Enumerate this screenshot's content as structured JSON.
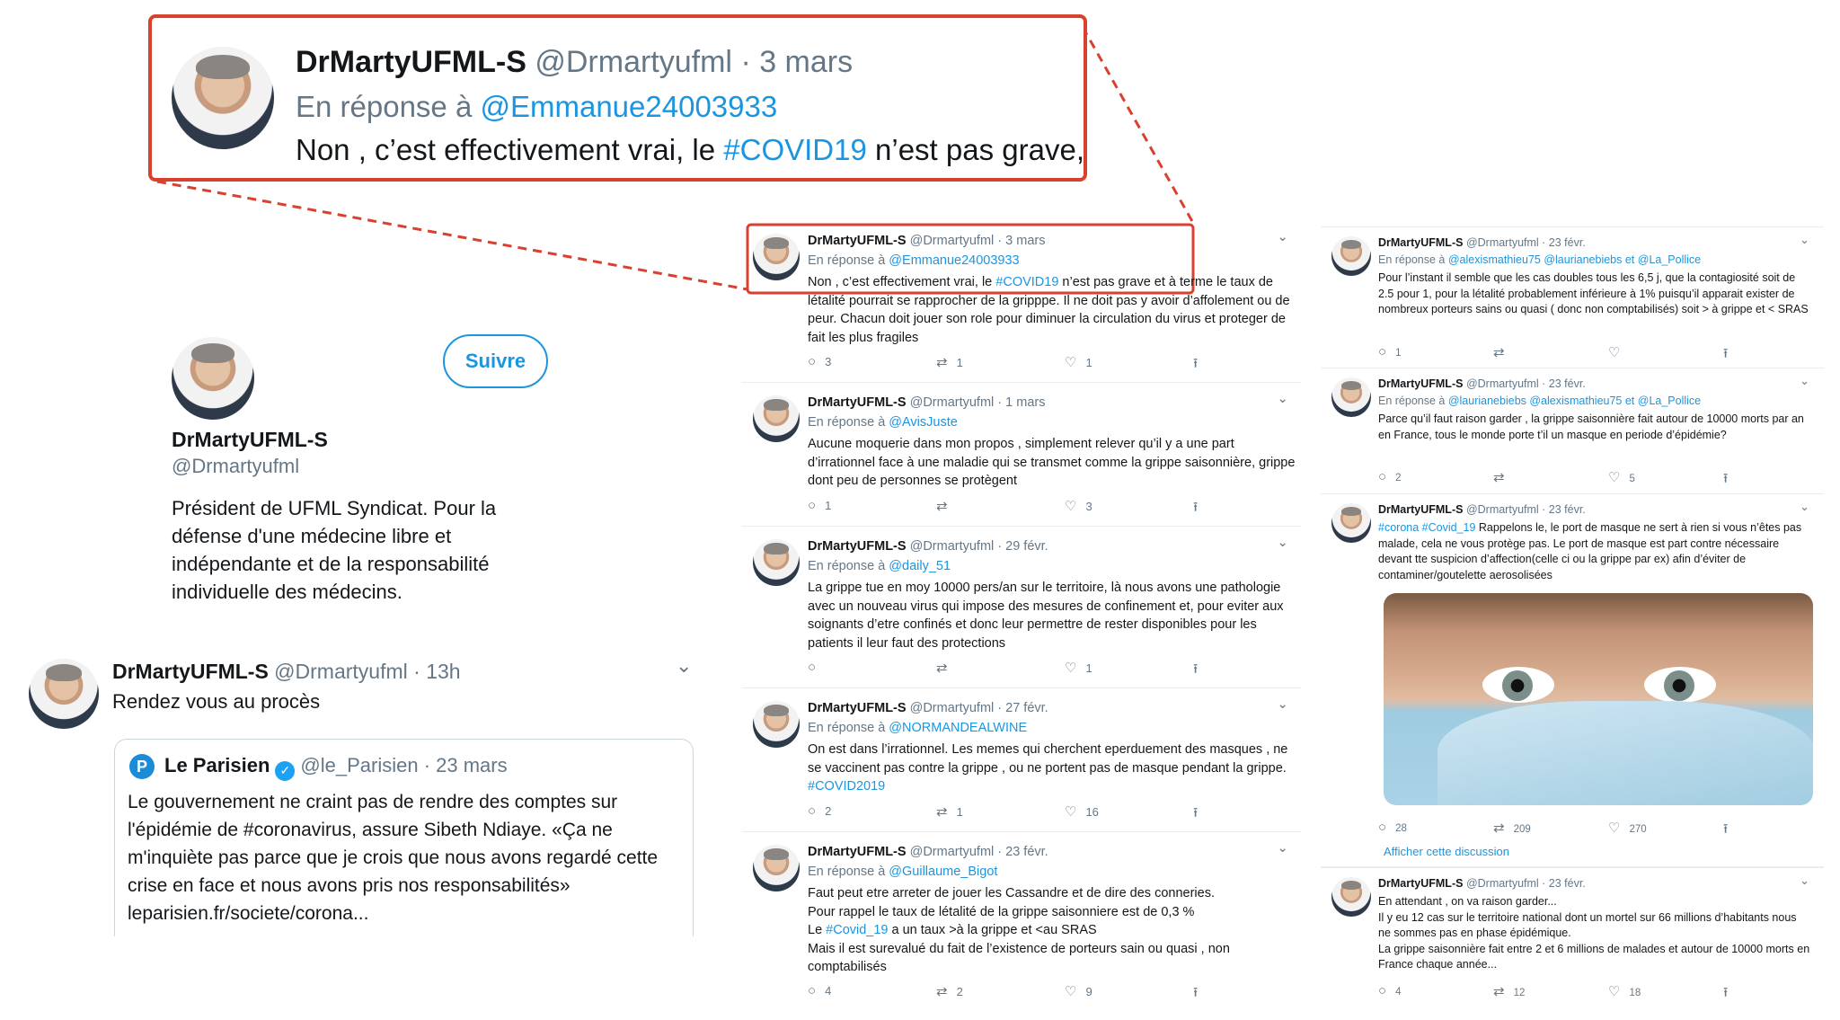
{
  "colors": {
    "accent": "#1b95e0",
    "highlight_red": "#d9412f",
    "muted": "#657786"
  },
  "zoom": {
    "name": "DrMartyUFML-S",
    "handle": "@Drmartyufml",
    "date": "· 3 mars",
    "reply_prefix": "En réponse à",
    "reply_to": "@Emmanue24003933",
    "text_before": "Non , c’est effectivement vrai, le",
    "hashtag": "#COVID19",
    "text_after": "n’est pas grave,"
  },
  "profile": {
    "follow_label": "Suivre",
    "name": "DrMartyUFML-S",
    "handle": "@Drmartyufml",
    "bio": "Président de UFML Syndicat. Pour la défense d'une médecine libre et indépendante et de la responsabilité individuelle des médecins."
  },
  "quote_tweet": {
    "name": "DrMartyUFML-S",
    "handle": "@Drmartyufml",
    "date": "· 13h",
    "text": "Rendez vous au procès",
    "quoted": {
      "logo_letter": "P",
      "name": "Le Parisien",
      "verified": "✓",
      "handle": "@le_Parisien",
      "date": "· 23 mars",
      "text": "Le gouvernement ne craint pas de rendre des comptes sur l'épidémie de #coronavirus, assure Sibeth Ndiaye. «Ça ne m'inquiète pas parce que je crois que nous avons regardé cette crise en face et nous avons pris nos responsabilités» leparisien.fr/societe/corona..."
    }
  },
  "middle_tweets": [
    {
      "name": "DrMartyUFML-S",
      "handle": "@Drmartyufml",
      "date": "· 3 mars",
      "reply_prefix": "En réponse à",
      "reply_to": "@Emmanue24003933",
      "body_a": "Non , c’est effectivement vrai, le ",
      "tag": "#COVID19",
      "body_b": " n’est pas grave et à terme le taux de létalité pourrait se rapprocher de la gripppe. Il ne doit pas y avoir d’affolement ou de peur. Chacun doit jouer son role pour diminuer la circulation du virus et proteger de fait les plus fragiles",
      "replies": "3",
      "retweets": "1",
      "likes": "1"
    },
    {
      "name": "DrMartyUFML-S",
      "handle": "@Drmartyufml",
      "date": "· 1 mars",
      "reply_prefix": "En réponse à",
      "reply_to": "@AvisJuste",
      "body": "Aucune moquerie dans mon propos , simplement relever qu’il y a une part d’irrationnel face à une maladie qui se transmet comme la grippe saisonnière, grippe dont peu de personnes se protègent",
      "replies": "1",
      "retweets": "",
      "likes": "3"
    },
    {
      "name": "DrMartyUFML-S",
      "handle": "@Drmartyufml",
      "date": "· 29 févr.",
      "reply_prefix": "En réponse à",
      "reply_to": "@daily_51",
      "body": "La grippe tue en moy 10000 pers/an sur le territoire, là nous avons une pathologie avec un nouveau virus qui impose des mesures de confinement et, pour eviter aux soignants d’etre confinés et donc leur permettre de rester disponibles pour les patients il leur faut des protections",
      "replies": "",
      "retweets": "",
      "likes": "1"
    },
    {
      "name": "DrMartyUFML-S",
      "handle": "@Drmartyufml",
      "date": "· 27 févr.",
      "reply_prefix": "En réponse à",
      "reply_to": "@NORMANDEALWINE",
      "body_a": "On est dans l’irrationnel. Les memes qui cherchent eperduement des masques , ne se vaccinent pas contre la grippe , ou ne portent pas de masque pendant la grippe. ",
      "tag": "#COVID2019",
      "body_b": "",
      "replies": "2",
      "retweets": "1",
      "likes": "16"
    },
    {
      "name": "DrMartyUFML-S",
      "handle": "@Drmartyufml",
      "date": "· 23 févr.",
      "reply_prefix": "En réponse à",
      "reply_to": "@Guillaume_Bigot",
      "body_l1": "Faut peut etre arreter de jouer les Cassandre et de dire des conneries.",
      "body_l2": "Pour rappel le taux de létalité de la grippe saisonniere est de 0,3 %",
      "body_l3a": "Le ",
      "body_l3tag": "#Covid_19",
      "body_l3b": " a un taux >à la grippe et <au SRAS",
      "body_l4": "Mais il est surevalué du fait de l’existence de porteurs sain ou quasi , non comptabilisés",
      "replies": "4",
      "retweets": "2",
      "likes": "9"
    }
  ],
  "right_tweets": [
    {
      "name": "DrMartyUFML-S",
      "handle": "@Drmartyufml",
      "date": "· 23 févr.",
      "reply_prefix": "En réponse à",
      "reply_to": "@alexismathieu75 @laurianebiebs  et  @La_Pollice",
      "body": "Pour l’instant il semble que les cas doubles tous les 6,5 j, que la contagiosité soit de 2.5 pour 1, pour la létalité probablement inférieure à 1% puisqu’il apparait exister de nombreux porteurs sains ou quasi ( donc non comptabilisés) soit > à grippe et < SRAS",
      "replies": "1",
      "retweets": "",
      "likes": ""
    },
    {
      "name": "DrMartyUFML-S",
      "handle": "@Drmartyufml",
      "date": "· 23 févr.",
      "reply_prefix": "En réponse à",
      "reply_to": "@laurianebiebs @alexismathieu75  et  @La_Pollice",
      "body": "Parce qu’il faut raison garder , la grippe saisonnière fait autour de 10000 morts par an  en France, tous le monde porte t’il un masque en periode d’épidémie?",
      "replies": "2",
      "retweets": "",
      "likes": "5"
    },
    {
      "name": "DrMartyUFML-S",
      "handle": "@Drmartyufml",
      "date": "· 23 févr.",
      "tags": "#corona #Covid_19",
      "body": " Rappelons le, le port de masque ne sert à rien si vous n’êtes pas malade, cela ne vous protège pas. Le port de masque est part contre nécessaire devant tte suspicion d’affection(celle ci ou la grippe par ex) afin d’éviter de contaminer/goutelette aerosolisées",
      "replies": "28",
      "retweets": "209",
      "likes": "270",
      "show_thread": "Afficher cette discussion"
    },
    {
      "name": "DrMartyUFML-S",
      "handle": "@Drmartyufml",
      "date": "· 23 févr.",
      "body": "En attendant , on va raison garder...\nIl y eu 12 cas sur le territoire national dont un mortel  sur 66 millions d’habitants nous ne sommes pas en phase épidémique.\nLa grippe saisonnière fait entre 2 et 6 millions de malades et autour de 10000 morts en France chaque année...",
      "replies": "4",
      "retweets": "12",
      "likes": "18"
    }
  ],
  "icons": {
    "reply": "○",
    "retweet": "⇄",
    "like": "♡",
    "share": "⭱",
    "chevron": "⌄"
  }
}
